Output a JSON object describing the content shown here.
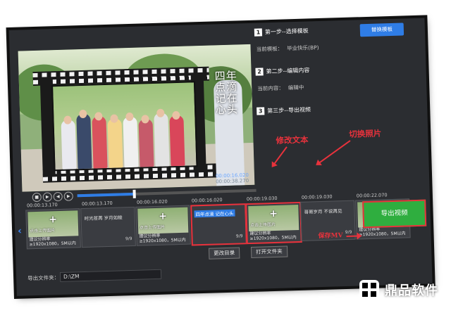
{
  "preview": {
    "vertical_text": "四年点滴 记在心头",
    "time_current": "00:00:16.020",
    "time_total": "00:00:38.270"
  },
  "steps": [
    {
      "number": "1",
      "title": "第一步--选择模板",
      "sub_label": "当前模板：",
      "sub_value": "毕业快乐(BP)",
      "button": "替换模板"
    },
    {
      "number": "2",
      "title": "第二步--编辑内容",
      "sub_label": "当前内容：",
      "sub_value": "编辑中"
    },
    {
      "number": "3",
      "title": "第三步--导出视频"
    }
  ],
  "annotations": {
    "edit_text": "修改文本",
    "switch_photo": "切换照片",
    "save_mv": "保存MV"
  },
  "timeline": {
    "ticks": [
      "00:00:13.170",
      "00:00:13.170",
      "00:00:16.020",
      "00:00:16.020",
      "00:00:19.030",
      "00:00:19.030",
      "00:00:22.070"
    ],
    "clips": [
      {
        "kind": "image",
        "overlay": "点击上传图片",
        "caption": "建议分辨率≥1920x1080，5M以内"
      },
      {
        "kind": "text",
        "text": "时光荏苒 岁月如梭",
        "count": "9/9"
      },
      {
        "kind": "image",
        "overlay": "点击上传图片",
        "caption": "建议分辨率≥1920x1080，5M以内"
      },
      {
        "kind": "text",
        "text": "四年点滴 记在心头",
        "count": "9/9"
      },
      {
        "kind": "image",
        "overlay": "点击上传图片",
        "caption": "建议分辨率≥1920x1080，5M以内"
      },
      {
        "kind": "text",
        "text": "哥哥岁月 不说再见",
        "count": "9/9"
      },
      {
        "kind": "image",
        "overlay": "",
        "caption": "建议分辨率≥1920x1080，5M以内"
      }
    ]
  },
  "bottom": {
    "change_dir": "更改目录",
    "open_folder": "打开文件夹",
    "export_label": "导出文件夹：",
    "export_path": "D:\\ZM",
    "export_button": "导出视频"
  },
  "watermark": {
    "text": "鼎品软件"
  },
  "colors": {
    "accent_blue": "#2f7de6",
    "annotation_red": "#e8323c",
    "export_green": "#2fae3f",
    "window_bg": "#2b2d31"
  }
}
